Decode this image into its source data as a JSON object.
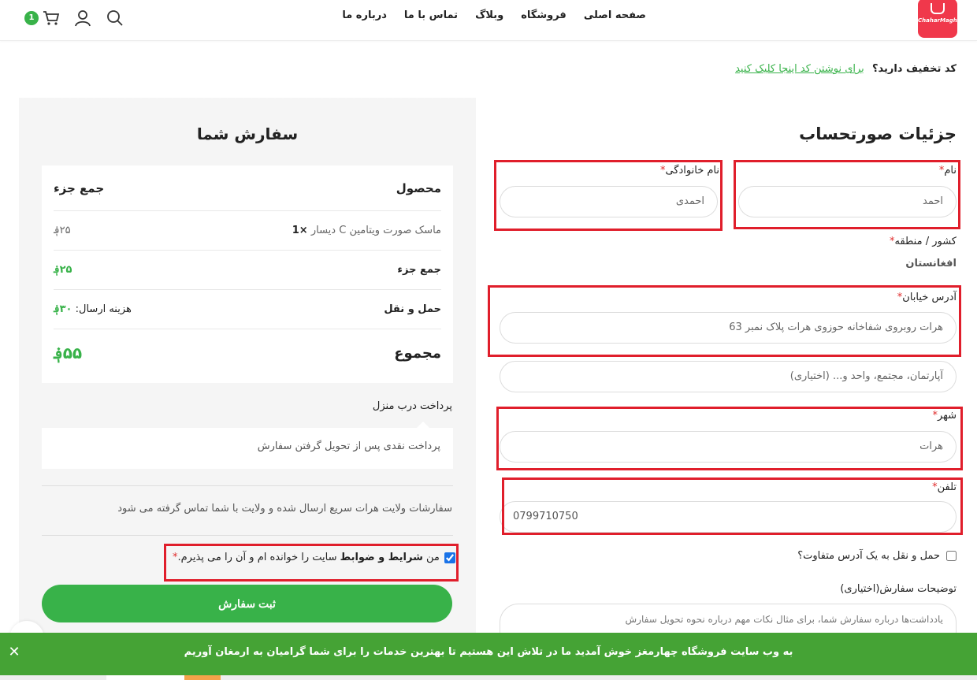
{
  "header": {
    "logo_text": "ChaharMaghz",
    "nav": [
      "صفحه اصلی",
      "فروشگاه",
      "وبلاگ",
      "تماس با ما",
      "درباره ما"
    ],
    "cart_count": "1",
    "icons": [
      "search-icon",
      "user-icon",
      "cart-icon"
    ]
  },
  "coupon": {
    "question": "کد تخفیف دارید؟",
    "link": "برای نوشتن کد اینجا کلیک کنید"
  },
  "billing": {
    "title": "جزئیات صورتحساب",
    "first_name": {
      "label": "نام",
      "value": "احمد"
    },
    "last_name": {
      "label": "نام خانوادگی",
      "value": "احمدی"
    },
    "country": {
      "label": "کشور / منطقه",
      "value": "افغانستان"
    },
    "address": {
      "label": "آدرس خیابان",
      "value": "هرات روبروی شفاخانه حوزوی هرات پلاک نمبر 63",
      "placeholder2": "آپارتمان، مجتمع، واحد و... (اختیاری)"
    },
    "city": {
      "label": "شهر",
      "value": "هرات"
    },
    "phone": {
      "label": "تلفن",
      "value": "0799710750"
    },
    "ship_different": "حمل و نقل به یک آدرس متفاوت؟",
    "notes_label": "توضیحات سفارش(اختیاری)",
    "notes_placeholder": "یادداشت‌ها درباره سفارش شما، برای مثال نکات مهم درباره نحوه تحویل سفارش"
  },
  "order": {
    "title": "سفارش شما",
    "col_product": "محصول",
    "col_subtotal": "جمع جزء",
    "item_name": "ماسک صورت ویتامین C دیسار",
    "item_qty": "×1",
    "item_price": "۲۵؋",
    "subtotal_label": "جمع جزء",
    "subtotal_value": "۲۵؋",
    "shipping_label": "حمل و نقل",
    "shipping_text": "هزینه ارسال:",
    "shipping_value": "۳۰؋",
    "total_label": "مجموع",
    "total_value": "۵۵؋",
    "payment_title": "پرداخت درب منزل",
    "payment_desc": "پرداخت نقدی پس از تحویل گرفتن سفارش",
    "note": "سفارشات ولایت هرات سریع ارسال شده و ولایت با شما تماس گرفته می شود",
    "terms_pre": "من",
    "terms_bold": "شرایط و ضوابط",
    "terms_post": "سایت را خوانده ام و آن را می پذیرم.",
    "submit": "ثبت سفارش"
  },
  "banner": {
    "message": "به وب سایت فروشگاه چهارمغز خوش آمدید ما در تلاش این هستیم تا بهترین خدمات را برای شما گرامیان به ارمغان آوریم"
  },
  "colors": {
    "accent": "#38b249",
    "highlight": "#e01e2b",
    "logo": "#f0384b"
  }
}
